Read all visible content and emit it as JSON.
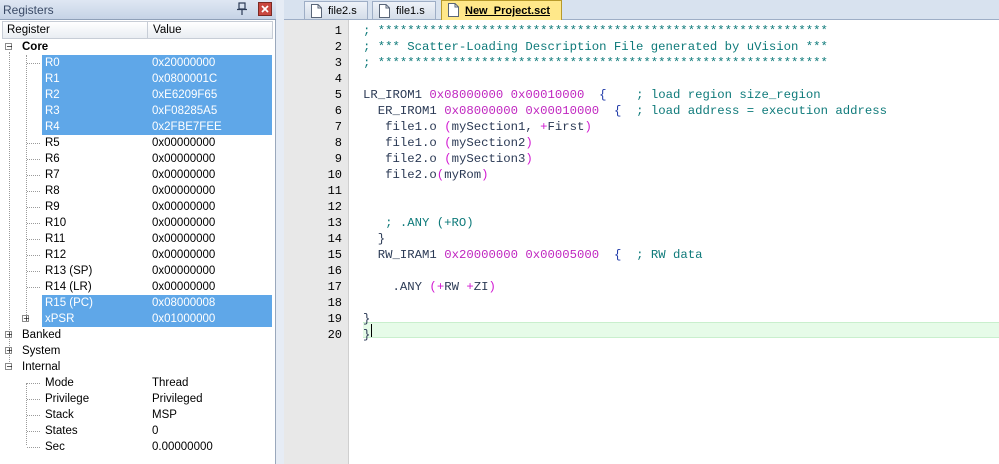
{
  "registers_panel": {
    "title": "Registers",
    "columns": [
      "Register",
      "Value"
    ],
    "core_label": "Core",
    "registers": [
      {
        "name": "R0",
        "value": "0x20000000",
        "selected": true
      },
      {
        "name": "R1",
        "value": "0x0800001C",
        "selected": true
      },
      {
        "name": "R2",
        "value": "0xE6209F65",
        "selected": true
      },
      {
        "name": "R3",
        "value": "0xF08285A5",
        "selected": true
      },
      {
        "name": "R4",
        "value": "0x2FBE7FEE",
        "selected": true
      },
      {
        "name": "R5",
        "value": "0x00000000",
        "selected": false
      },
      {
        "name": "R6",
        "value": "0x00000000",
        "selected": false
      },
      {
        "name": "R7",
        "value": "0x00000000",
        "selected": false
      },
      {
        "name": "R8",
        "value": "0x00000000",
        "selected": false
      },
      {
        "name": "R9",
        "value": "0x00000000",
        "selected": false
      },
      {
        "name": "R10",
        "value": "0x00000000",
        "selected": false
      },
      {
        "name": "R11",
        "value": "0x00000000",
        "selected": false
      },
      {
        "name": "R12",
        "value": "0x00000000",
        "selected": false
      },
      {
        "name": "R13 (SP)",
        "value": "0x00000000",
        "selected": false
      },
      {
        "name": "R14 (LR)",
        "value": "0x00000000",
        "selected": false
      },
      {
        "name": "R15 (PC)",
        "value": "0x08000008",
        "selected": true
      },
      {
        "name": "xPSR",
        "value": "0x01000000",
        "selected": true
      }
    ],
    "groups": [
      "Banked",
      "System",
      "Internal"
    ],
    "internal": [
      {
        "name": "Mode",
        "value": "Thread"
      },
      {
        "name": "Privilege",
        "value": "Privileged"
      },
      {
        "name": "Stack",
        "value": "MSP"
      },
      {
        "name": "States",
        "value": "0"
      },
      {
        "name": "Sec",
        "value": "0.00000000"
      }
    ],
    "icons": {
      "pin": "pin-icon",
      "close": "close-icon"
    }
  },
  "editor": {
    "tabs": [
      {
        "label": "file2.s",
        "active": false
      },
      {
        "label": "file1.s",
        "active": false
      },
      {
        "label": "New_Project.sct",
        "active": true
      }
    ],
    "line_numbers": [
      "1",
      "2",
      "3",
      "4",
      "5",
      "6",
      "7",
      "8",
      "9",
      "10",
      "11",
      "12",
      "13",
      "14",
      "15",
      "16",
      "17",
      "18",
      "19",
      "20"
    ],
    "lines": [
      "; *************************************************************",
      "; *** Scatter-Loading Description File generated by uVision ***",
      "; *************************************************************",
      "",
      "LR_IROM1 0x08000000 0x00010000  {    ; load region size_region",
      "  ER_IROM1 0x08000000 0x00010000  {  ; load address = execution address",
      "   file1.o (mySection1, +First)",
      "   file1.o (mySection2)",
      "   file2.o (mySection3)",
      "   file2.o(myRom)",
      "",
      "",
      "   ; .ANY (+RO)",
      "  }",
      "  RW_IRAM1 0x20000000 0x00005000  {  ; RW data",
      "",
      "    .ANY (+RW +ZI)",
      "",
      "}",
      "}"
    ],
    "current_line": "20"
  },
  "colors": {
    "selection": "#5fa7e8",
    "comment": "#0e7a7a",
    "number": "#c026c0",
    "current_line_bg": "#e6fbe8",
    "active_tab": "#ffe88a"
  }
}
